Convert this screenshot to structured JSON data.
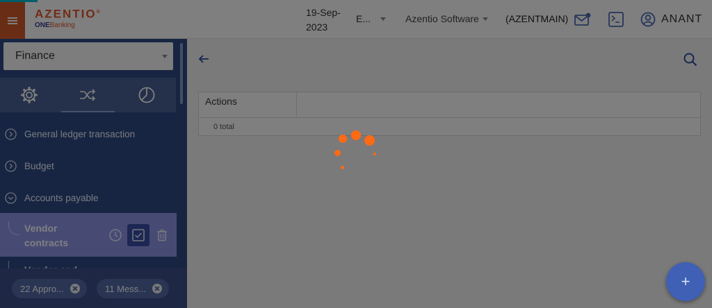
{
  "header": {
    "logo": {
      "brand": "AZENTIO",
      "trademark": "®",
      "sub_one": "ONE",
      "sub_banking": "Banking"
    },
    "date": "19-Sep-2023",
    "language": "E...",
    "company": "Azentio Software",
    "branch": "(AZENTMAIN)",
    "user": "ANANT",
    "icons": {
      "menu": "hamburger-menu-icon",
      "mail": "mail-notification-icon",
      "terminal": "terminal-icon",
      "user": "account-circle-icon"
    }
  },
  "sidebar": {
    "module": "Finance",
    "tabs": [
      {
        "icon": "settings-gear-icon"
      },
      {
        "icon": "shuffle-icon"
      },
      {
        "icon": "pie-chart-icon"
      }
    ],
    "nav_items": [
      {
        "label": "General ledger transaction",
        "state": "collapsed"
      },
      {
        "label": "Budget",
        "state": "collapsed"
      },
      {
        "label": "Accounts payable",
        "state": "expanded"
      }
    ],
    "selected_sub_item": {
      "label_line1": "Vendor",
      "label_line2": "contracts"
    },
    "next_sub_item": "Vendor and",
    "notifications": [
      {
        "label": "22 Appro..."
      },
      {
        "label": "11 Mess..."
      }
    ]
  },
  "main": {
    "grid": {
      "columns": [
        "Actions"
      ],
      "total_label": "0 total"
    },
    "fab_label": "+",
    "loading": true,
    "spinner_color": "#ff6a13"
  }
}
